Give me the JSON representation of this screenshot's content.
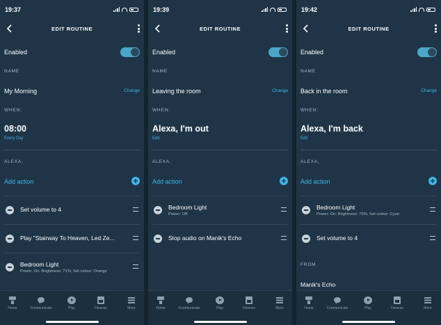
{
  "header_title": "EDIT ROUTINE",
  "enabled_label": "Enabled",
  "name_section": "NAME",
  "change_label": "Change",
  "when_section": "WHEN:",
  "alexa_section": "ALEXA,",
  "add_action_label": "Add action",
  "from_section": "FROM",
  "toggle_color": "#4aa7c9",
  "accent_color": "#3fb6e8",
  "tabs": [
    {
      "label": "Home",
      "icon": "home-icon"
    },
    {
      "label": "Communicate",
      "icon": "chat-bubble-icon"
    },
    {
      "label": "Play",
      "icon": "play-icon"
    },
    {
      "label": "Devices",
      "icon": "devices-icon"
    },
    {
      "label": "More",
      "icon": "menu-icon"
    }
  ],
  "screens": [
    {
      "time": "19:37",
      "routine_name": "My Morning",
      "trigger": "08:00",
      "trigger_sub": "Every Day",
      "actions": [
        {
          "title": "Set volume to 4",
          "detail": ""
        },
        {
          "title": "Play \"Stairway To Heaven, Led Ze...",
          "detail": ""
        },
        {
          "title": "Bedroom Light",
          "detail": "Power: On; Brightness: 71%; Set colour: Orange"
        }
      ]
    },
    {
      "time": "19:39",
      "routine_name": "Leaving the room",
      "trigger": "Alexa, I'm out",
      "trigger_sub": "Edit",
      "actions": [
        {
          "title": "Bedroom Light",
          "detail": "Power: Off"
        },
        {
          "title": "Stop audio on Manik's Echo",
          "detail": ""
        }
      ]
    },
    {
      "time": "19:42",
      "routine_name": "Back in the room",
      "trigger": "Alexa, I'm back",
      "trigger_sub": "Edit",
      "actions": [
        {
          "title": "Bedroom Light",
          "detail": "Power: On; Brightness: 75%; Set colour: Cyan"
        },
        {
          "title": "Set volume to 4",
          "detail": ""
        }
      ],
      "from_value": "Manik's Echo"
    }
  ]
}
